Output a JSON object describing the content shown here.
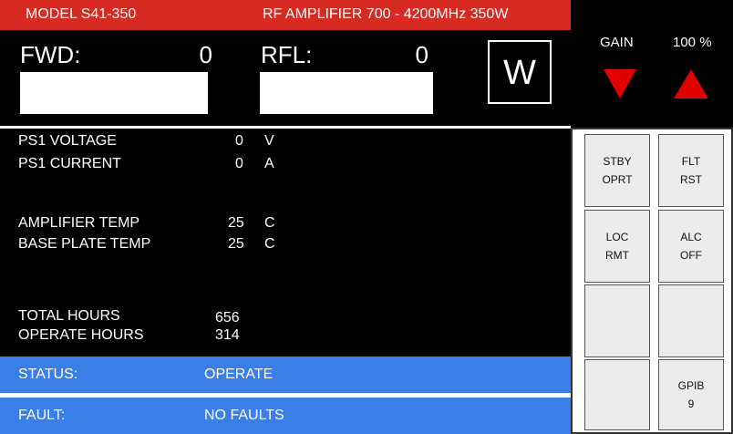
{
  "header": {
    "model": "MODEL S41-350",
    "description": "RF AMPLIFIER 700 - 4200MHz 350W"
  },
  "power": {
    "fwd_label": "FWD:",
    "fwd_value": "0",
    "rfl_label": "RFL:",
    "rfl_value": "0",
    "unit": "W"
  },
  "gain": {
    "label": "GAIN",
    "value": "100 %"
  },
  "readings": {
    "ps1_voltage_label": "PS1 VOLTAGE",
    "ps1_voltage_value": "0",
    "ps1_voltage_unit": "V",
    "ps1_current_label": "PS1 CURRENT",
    "ps1_current_value": "0",
    "ps1_current_unit": "A",
    "amp_temp_label": "AMPLIFIER TEMP",
    "amp_temp_value": "25",
    "amp_temp_unit": "C",
    "base_temp_label": "BASE PLATE TEMP",
    "base_temp_value": "25",
    "base_temp_unit": "C",
    "total_hours_label": "TOTAL HOURS",
    "total_hours_value": "656",
    "operate_hours_label": "OPERATE HOURS",
    "operate_hours_value": "314"
  },
  "status": {
    "status_label": "STATUS:",
    "status_value": "OPERATE",
    "fault_label": "FAULT:",
    "fault_value": "NO FAULTS"
  },
  "buttons": {
    "stby_line1": "STBY",
    "stby_line2": "OPRT",
    "flt_line1": "FLT",
    "flt_line2": "RST",
    "loc_line1": "LOC",
    "loc_line2": "RMT",
    "alc_line1": "ALC",
    "alc_line2": "OFF",
    "gpib_line1": "GPIB",
    "gpib_line2": "9"
  },
  "colors": {
    "header_red": "#d62a22",
    "status_blue": "#3b7ee8",
    "arrow_red": "#e00000",
    "panel_black": "#000000"
  }
}
